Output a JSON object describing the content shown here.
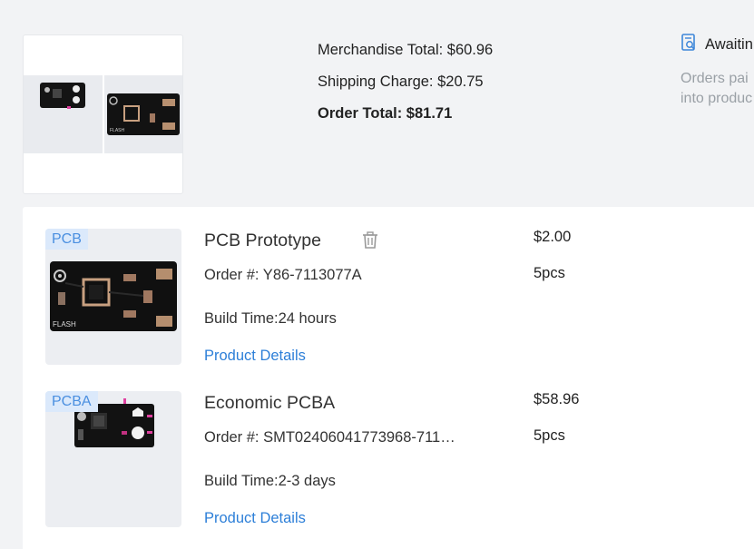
{
  "summary": {
    "merchandise_total": "Merchandise Total: $60.96",
    "shipping_charge": "Shipping Charge: $20.75",
    "order_total": "Order Total: $81.71",
    "status_title": "Awaitin",
    "status_desc_line1": "Orders pai",
    "status_desc_line2": "into produc"
  },
  "items": [
    {
      "tag": "PCB",
      "title": "PCB Prototype",
      "order": "Order #: Y86-7113077A",
      "build": "Build Time:24 hours",
      "details_link": "Product Details",
      "price": "$2.00",
      "qty": "5pcs",
      "silkscreen": "FLASH"
    },
    {
      "tag": "PCBA",
      "title": "Economic PCBA",
      "order": "Order #: SMT02406041773968-711…",
      "build": "Build Time:2-3 days",
      "details_link": "Product Details",
      "price": "$58.96",
      "qty": "5pcs"
    }
  ],
  "colors": {
    "tag_bg": "#dbe9fb",
    "tag_text": "#4a8fe0",
    "link": "#2d7fd8",
    "status_icon": "#3d86d9"
  },
  "icons": {
    "status": "document-search-icon",
    "delete": "trash-icon"
  }
}
